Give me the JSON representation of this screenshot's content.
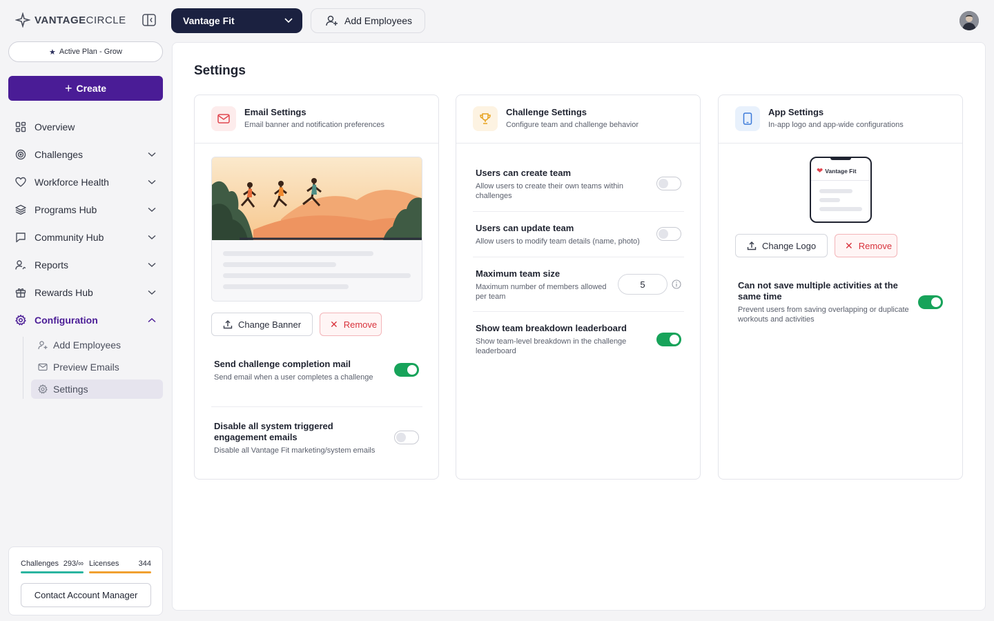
{
  "brand": {
    "logo_text_bold": "VANTAGE",
    "logo_text": "CIRCLE"
  },
  "topbar": {
    "app_selector": "Vantage Fit",
    "add_employees": "Add Employees"
  },
  "sidebar": {
    "plan_badge": "Active Plan - Grow",
    "create_label": "Create",
    "items": [
      {
        "label": "Overview",
        "icon": "grid-icon"
      },
      {
        "label": "Challenges",
        "icon": "target-icon"
      },
      {
        "label": "Workforce Health",
        "icon": "heart-icon"
      },
      {
        "label": "Programs Hub",
        "icon": "layers-icon"
      },
      {
        "label": "Community Hub",
        "icon": "chat-icon"
      },
      {
        "label": "Reports",
        "icon": "user-chart-icon"
      },
      {
        "label": "Rewards Hub",
        "icon": "gift-icon"
      },
      {
        "label": "Configuration",
        "icon": "gear-icon"
      }
    ],
    "subitems": [
      {
        "label": "Add Employees"
      },
      {
        "label": "Preview Emails"
      },
      {
        "label": "Settings"
      }
    ],
    "usage": {
      "challenges_label": "Challenges",
      "challenges_value": "293/∞",
      "licenses_label": "Licenses",
      "licenses_value": "344",
      "challenges_color": "#2bb5a0",
      "licenses_color": "#f0a030"
    },
    "contact_label": "Contact Account Manager"
  },
  "page": {
    "title": "Settings"
  },
  "email_card": {
    "title": "Email Settings",
    "subtitle": "Email banner and notification preferences",
    "change_banner": "Change Banner",
    "remove": "Remove",
    "settings": [
      {
        "title": "Send challenge completion mail",
        "desc": "Send email when a user completes a challenge",
        "enabled": true
      },
      {
        "title": "Disable all system triggered engagement emails",
        "desc": "Disable all Vantage Fit marketing/system emails",
        "enabled": false
      }
    ]
  },
  "challenge_card": {
    "title": "Challenge Settings",
    "subtitle": "Configure team and challenge behavior",
    "settings": [
      {
        "title": "Users can create team",
        "desc": "Allow users to create their own teams within challenges",
        "enabled": false
      },
      {
        "title": "Users can update team",
        "desc": "Allow users to modify team details (name, photo)",
        "enabled": false
      },
      {
        "title": "Maximum team size",
        "desc": "Maximum number of members allowed per team",
        "value": "5"
      },
      {
        "title": "Show team breakdown leaderboard",
        "desc": "Show team-level breakdown in the challenge leaderboard",
        "enabled": true
      }
    ]
  },
  "app_card": {
    "title": "App Settings",
    "subtitle": "In-app logo and app-wide configurations",
    "preview_logo": "Vantage Fit",
    "change_logo": "Change Logo",
    "remove": "Remove",
    "settings": [
      {
        "title": "Can not save multiple activities at the same time",
        "desc": "Prevent users from saving overlapping or duplicate workouts and activities",
        "enabled": true
      }
    ]
  }
}
